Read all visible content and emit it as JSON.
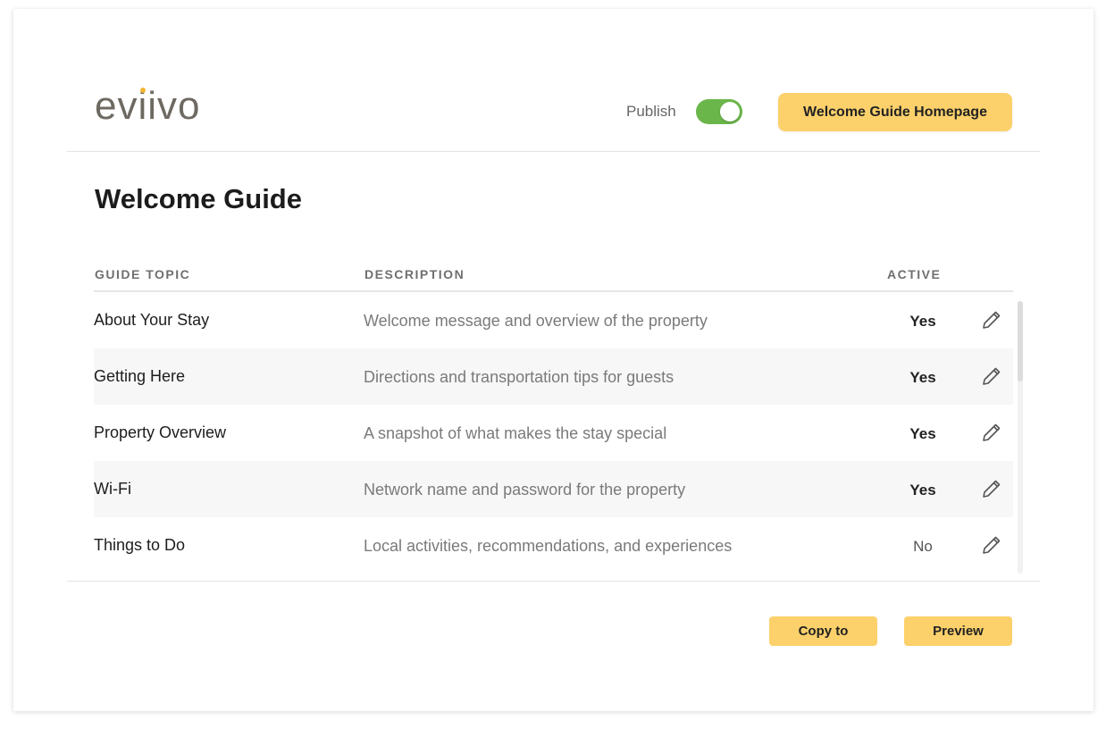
{
  "brand": {
    "logo_text": "eviivo"
  },
  "header": {
    "publish_label": "Publish",
    "publish_on": true,
    "homepage_button": "Welcome Guide Homepage"
  },
  "page": {
    "title": "Welcome Guide"
  },
  "table": {
    "columns": [
      "GUIDE TOPIC",
      "DESCRIPTION",
      "ACTIVE"
    ],
    "rows": [
      {
        "topic": "About Your Stay",
        "description": "Welcome message and overview of the property",
        "active": "Yes"
      },
      {
        "topic": "Getting Here",
        "description": "Directions and transportation tips for guests",
        "active": "Yes"
      },
      {
        "topic": "Property Overview",
        "description": "A snapshot of what makes the stay special",
        "active": "Yes"
      },
      {
        "topic": "Wi-Fi",
        "description": "Network name and password for the property",
        "active": "Yes"
      },
      {
        "topic": "Things to Do",
        "description": "Local activities, recommendations, and experiences",
        "active": "No"
      }
    ]
  },
  "footer": {
    "copy_button": "Copy to",
    "preview_button": "Preview"
  },
  "colors": {
    "accent_button": "#fcd16b",
    "toggle_on": "#6bb64a",
    "logo_gray": "#6e6a62",
    "logo_dot": "#f2b632"
  },
  "icons": {
    "edit": "pencil-icon"
  }
}
